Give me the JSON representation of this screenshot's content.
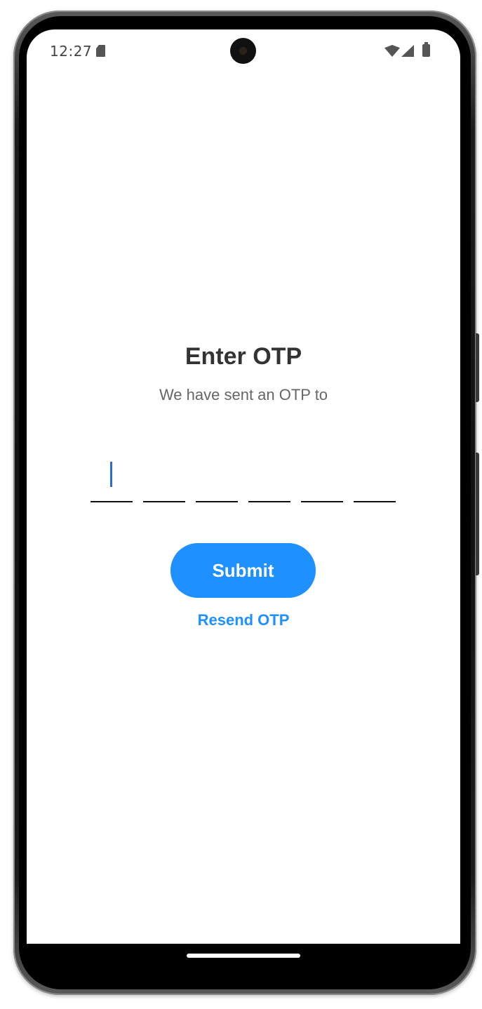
{
  "status_bar": {
    "time": "12:27",
    "icons": [
      "sd-card-icon",
      "wifi-icon",
      "signal-icon",
      "battery-icon"
    ]
  },
  "otp_screen": {
    "title": "Enter OTP",
    "subtitle": "We have sent an OTP to",
    "otp_digits": [
      "",
      "",
      "",
      "",
      "",
      ""
    ],
    "submit_label": "Submit",
    "resend_label": "Resend OTP"
  },
  "colors": {
    "accent": "#1e90ff",
    "title_text": "#333333",
    "subtitle_text": "#666666",
    "cursor": "#2a6bd6"
  }
}
